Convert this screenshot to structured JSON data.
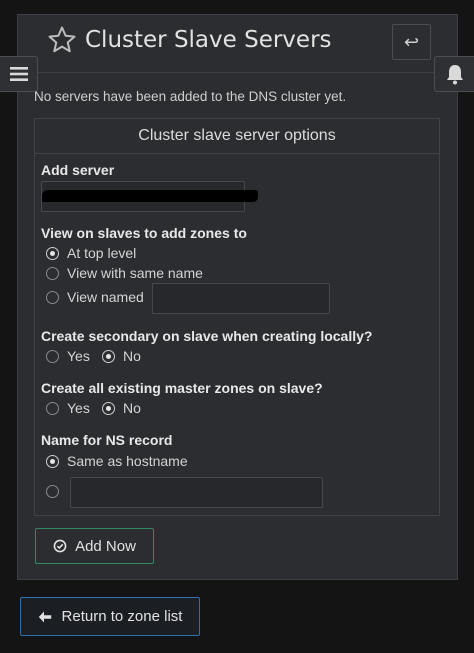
{
  "header": {
    "title": "Cluster Slave Servers",
    "star_icon": "star-icon",
    "back_icon": "return-arrow-icon",
    "back_glyph": "↩"
  },
  "side": {
    "menu_icon": "hamburger-menu-icon",
    "bell_icon": "bell-icon"
  },
  "info": "No servers have been added to the DNS cluster yet.",
  "options": {
    "heading": "Cluster slave server options",
    "add_server": {
      "label": "Add server",
      "value": ""
    },
    "view": {
      "label": "View on slaves to add zones to",
      "opt_top": "At top level",
      "opt_same": "View with same name",
      "opt_named": "View named",
      "selected": "At top level",
      "named_value": ""
    },
    "secondary": {
      "label": "Create secondary on slave when creating locally?",
      "yes": "Yes",
      "no": "No",
      "selected": "No"
    },
    "existing": {
      "label": "Create all existing master zones on slave?",
      "yes": "Yes",
      "no": "No",
      "selected": "No"
    },
    "ns": {
      "label": "Name for NS record",
      "opt_same": "Same as hostname",
      "selected": "Same as hostname",
      "custom_value": ""
    }
  },
  "buttons": {
    "add_now": "Add Now",
    "return": "Return to zone list"
  },
  "colors": {
    "add_border": "#2f8a63",
    "return_border": "#2f6fb3"
  }
}
